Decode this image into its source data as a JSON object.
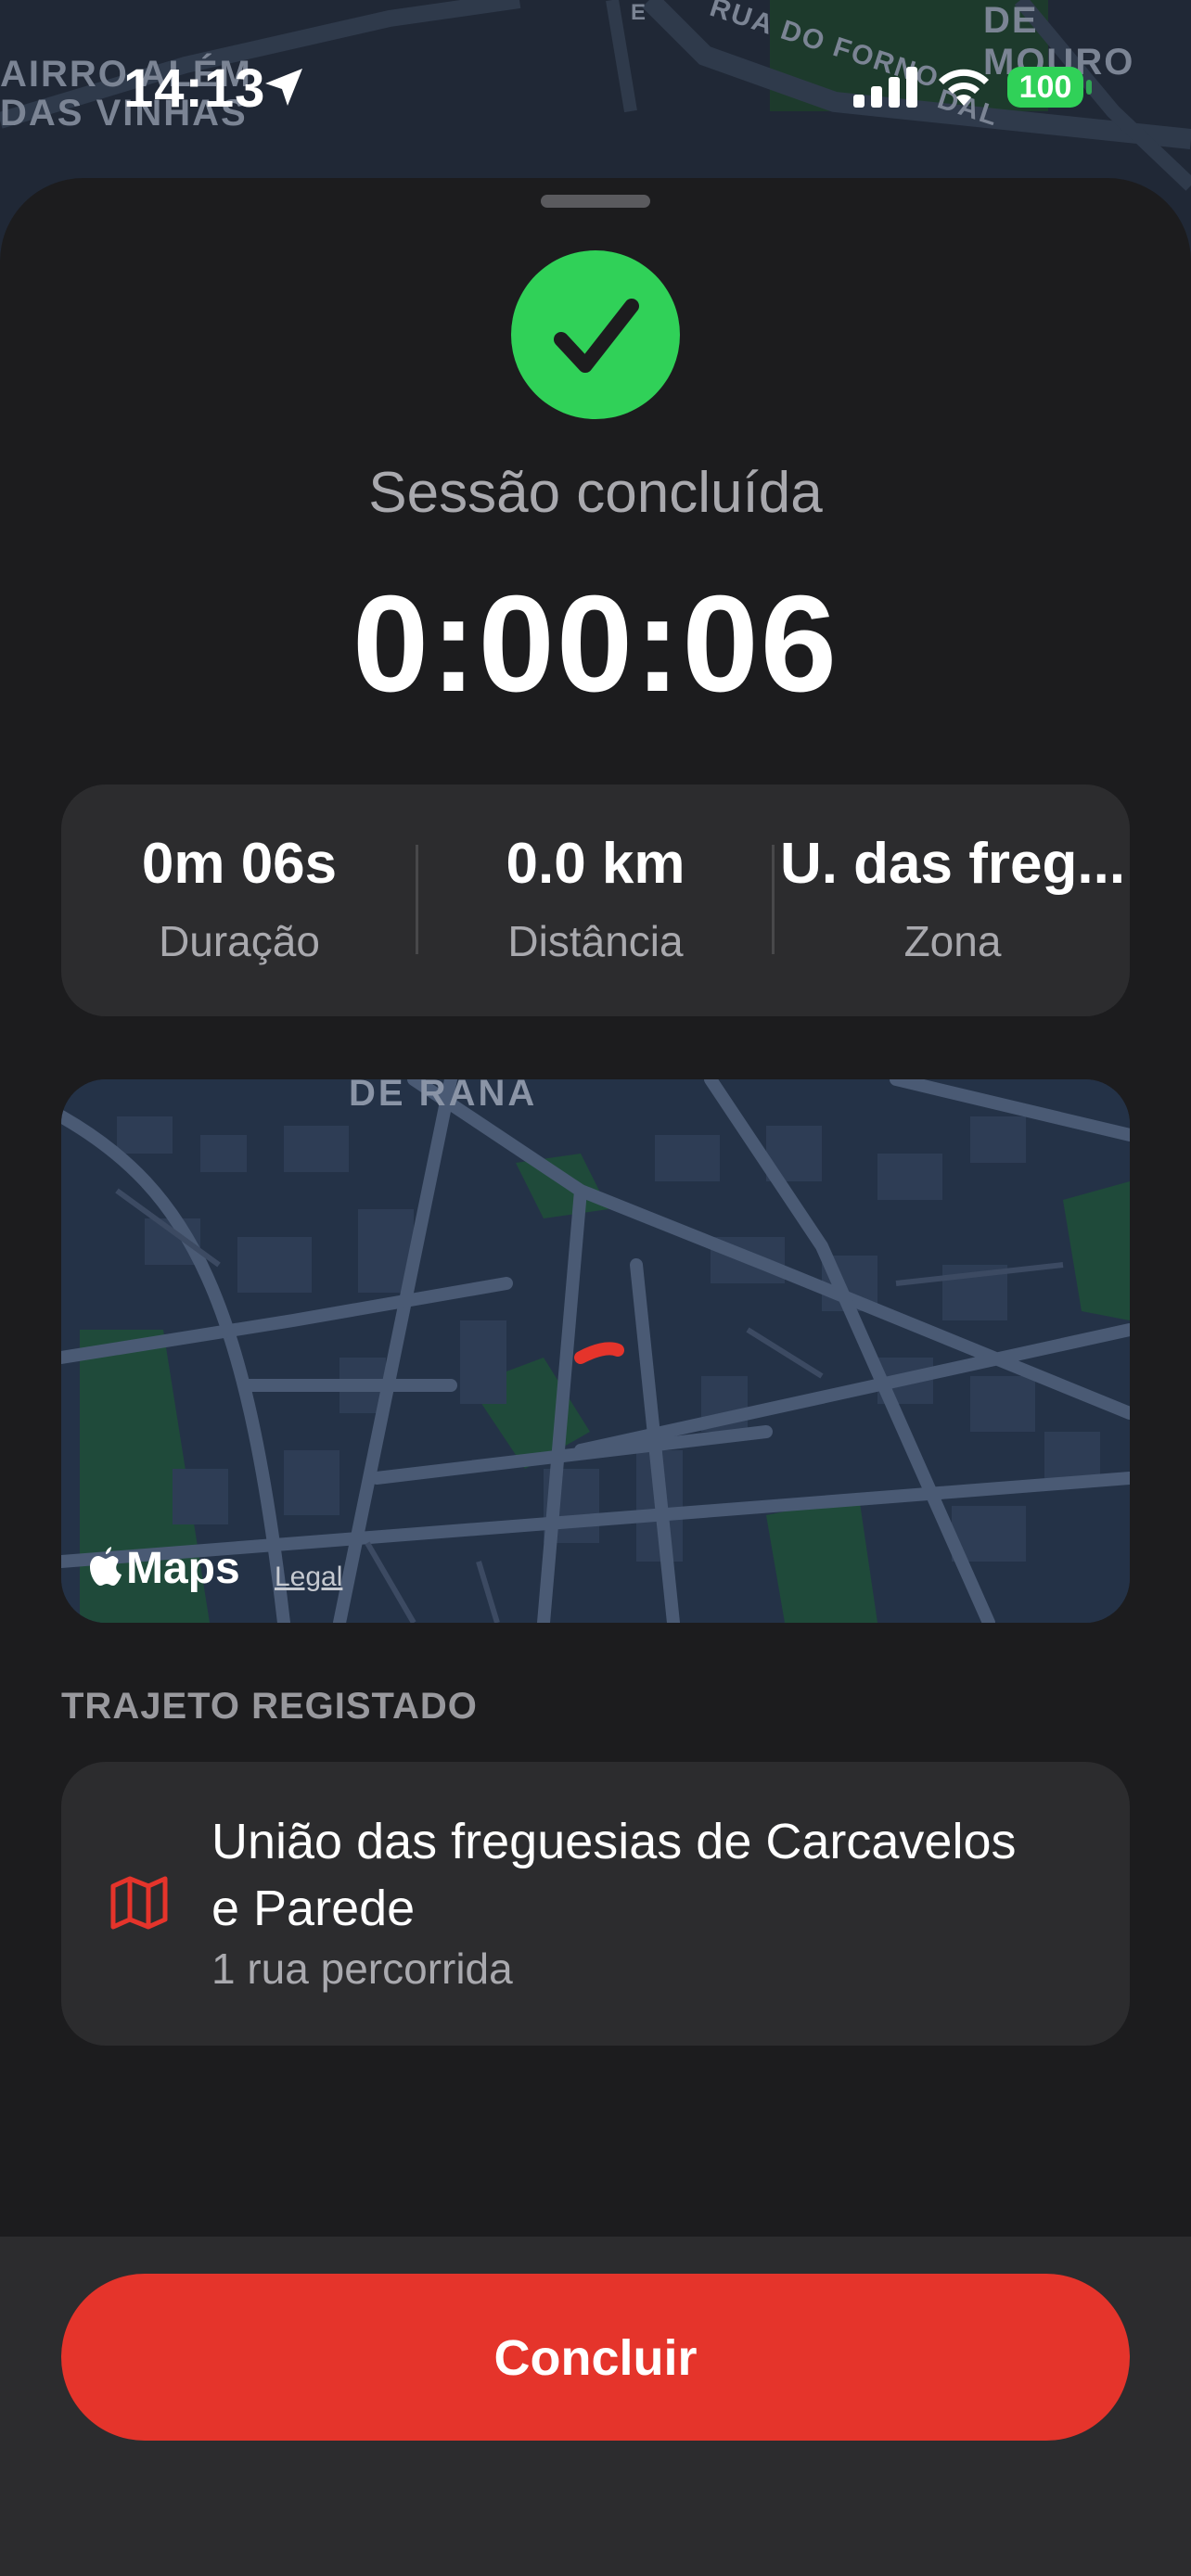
{
  "status_bar": {
    "time": "14:13",
    "battery": "100",
    "icons": [
      "location-arrow-icon",
      "signal-icon",
      "wifi-icon",
      "battery-icon"
    ]
  },
  "background_map": {
    "labels": [
      "AIRRO ALÉM",
      "DAS VINHAS",
      "RUA DO FORNO",
      "DE MOURO",
      "DAL",
      "E"
    ]
  },
  "session": {
    "subtitle": "Sessão concluída",
    "timer": "0:00:06",
    "icon": "checkmark-icon"
  },
  "stats": [
    {
      "value": "0m 06s",
      "label": "Duração"
    },
    {
      "value": "0.0 km",
      "label": "Distância"
    },
    {
      "value": "U. das freg...",
      "label": "Zona"
    }
  ],
  "map": {
    "label": "DE RANA",
    "brand": "Maps",
    "legal": "Legal",
    "route_color": "#e5342b"
  },
  "route_section": {
    "title": "TRAJETO REGISTADO",
    "item": {
      "name": "União das freguesias de Carcavelos e Parede",
      "detail": "1 rua percorrida",
      "icon": "map-icon"
    }
  },
  "actions": {
    "finish": "Concluir"
  },
  "colors": {
    "accent_green": "#30d158",
    "accent_red": "#e5342b",
    "card": "#2c2c2e",
    "background": "#1c1c1e"
  }
}
